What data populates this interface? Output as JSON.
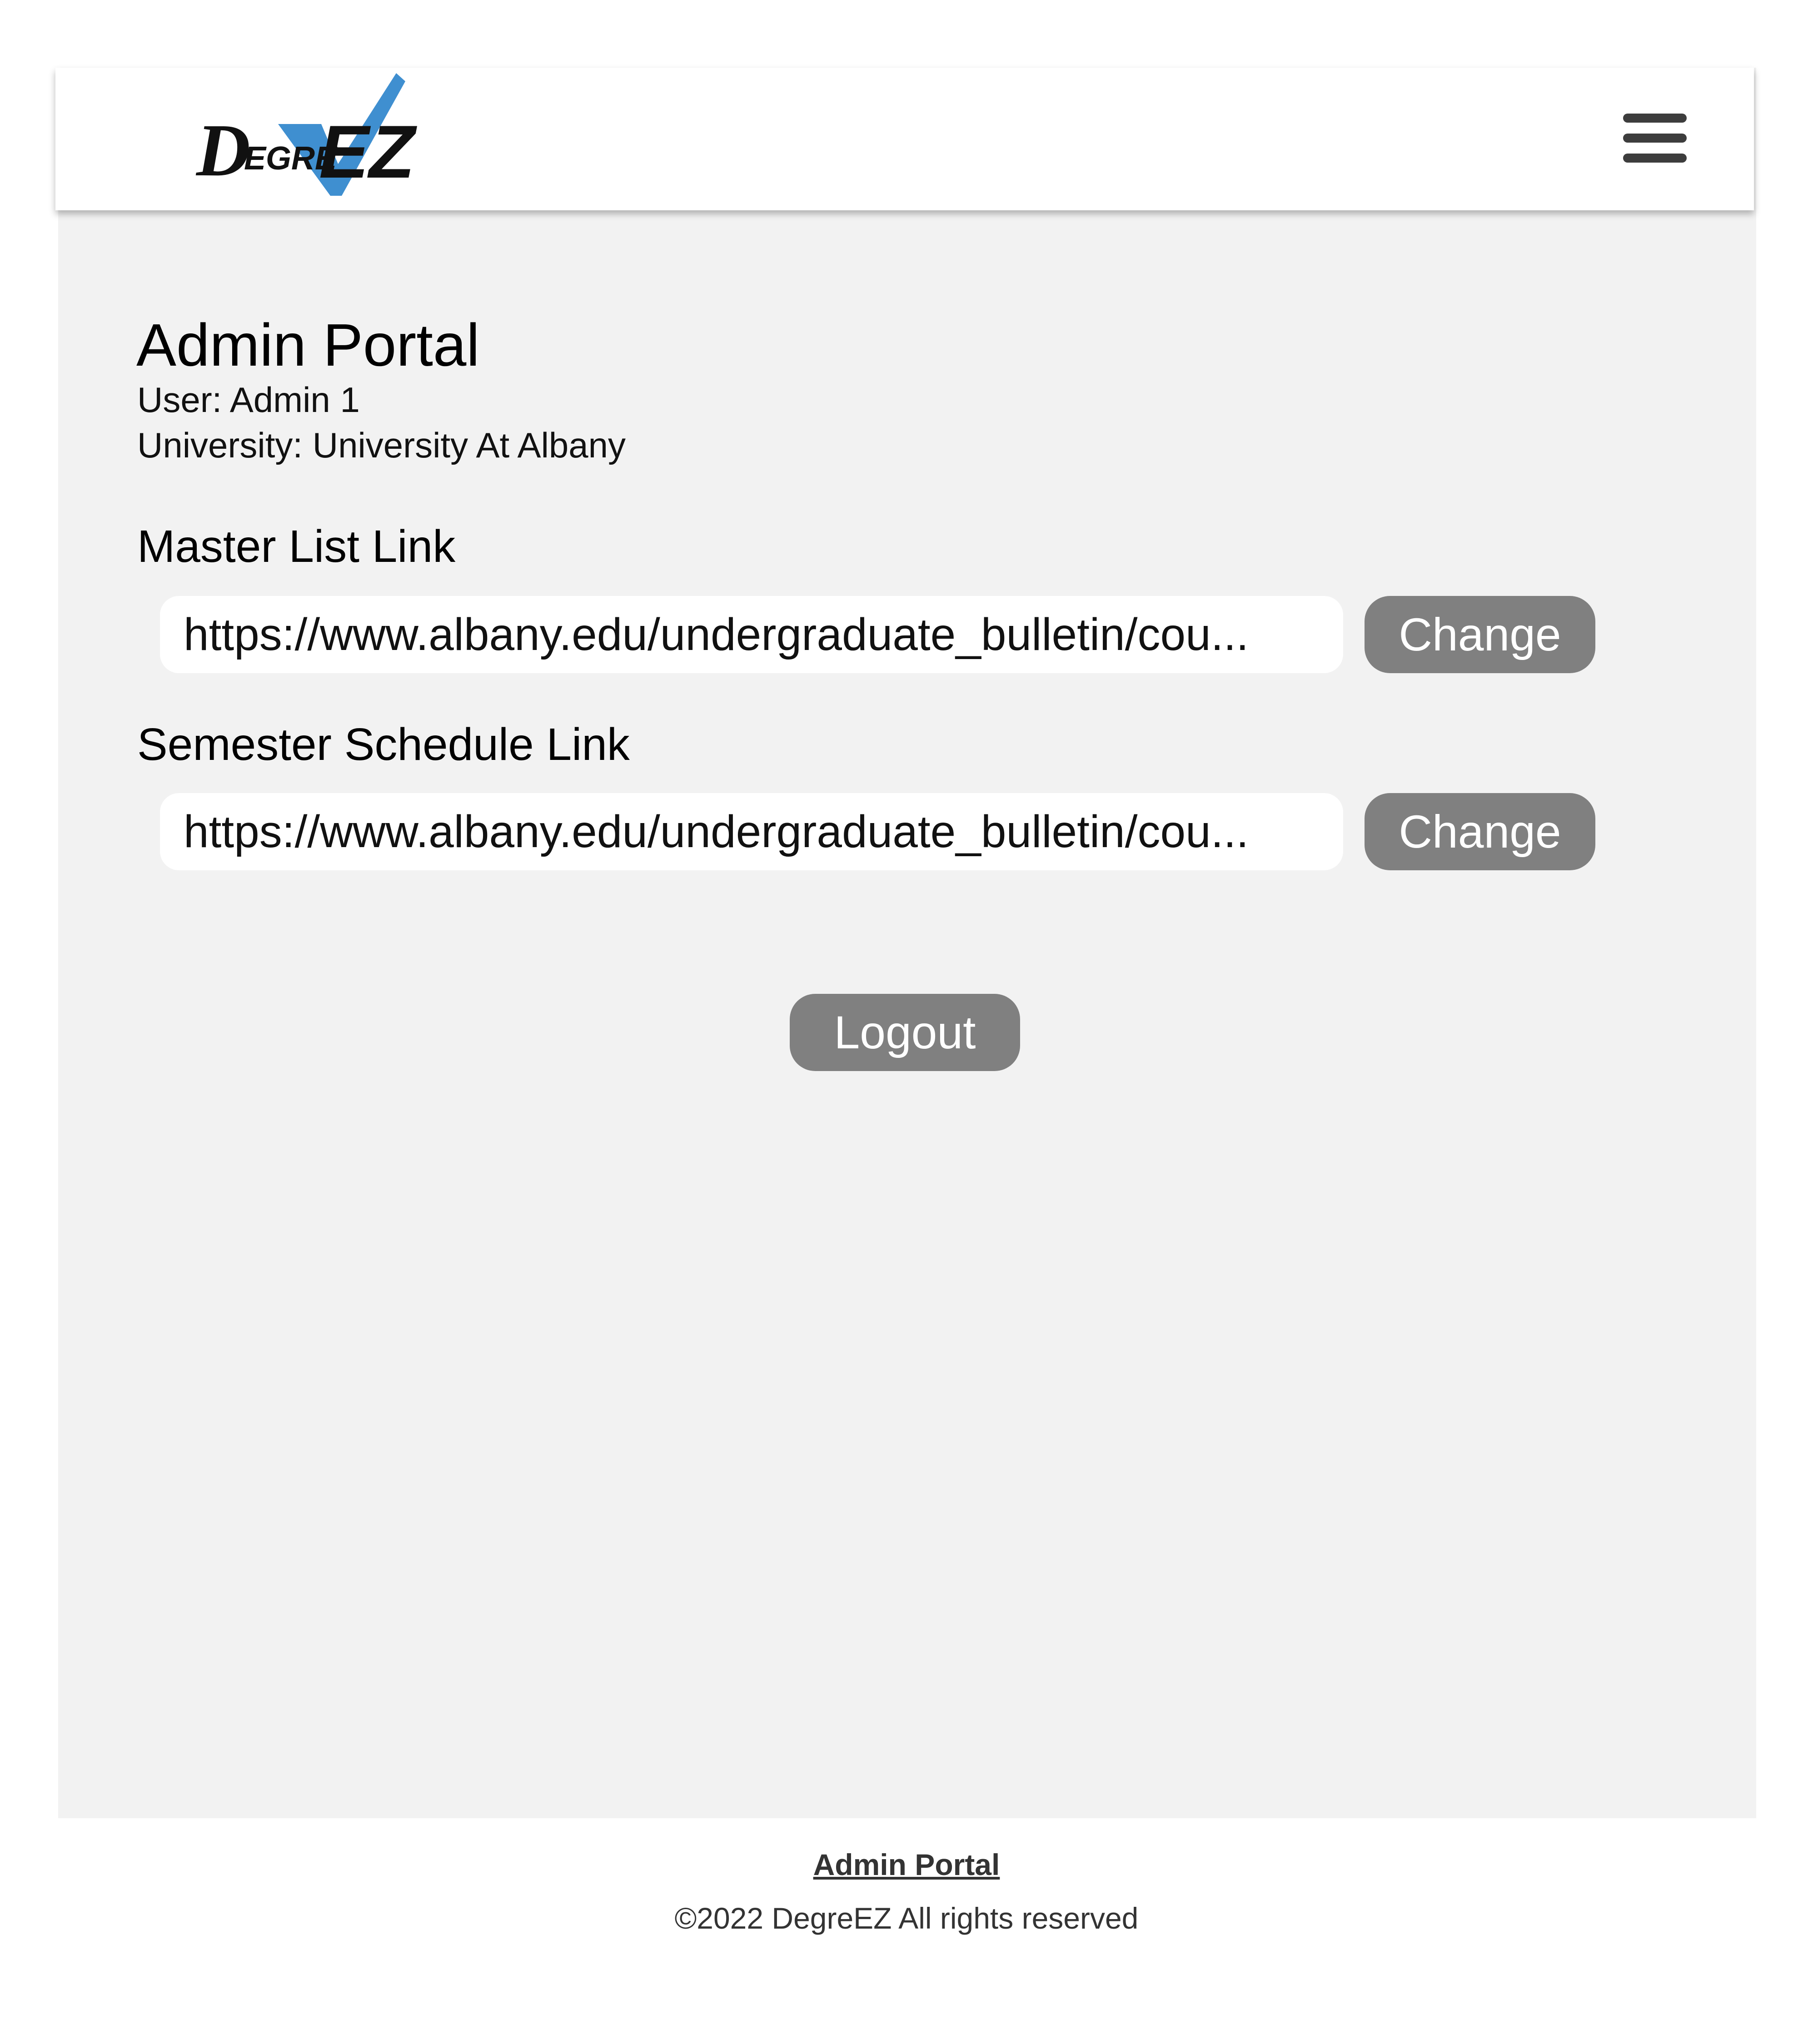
{
  "header": {
    "logo": {
      "text_initial": "D",
      "text_middle": "EGRE",
      "text_end": "EZ",
      "check_color": "#3f8fd0",
      "icon": "checkmark-icon"
    },
    "menu_icon": "hamburger-menu-icon"
  },
  "main": {
    "title": "Admin Portal",
    "user_line": "User: Admin 1",
    "university_line": "University: University At Albany",
    "master_list": {
      "label": "Master List Link",
      "value": "https://www.albany.edu/undergraduate_bulletin/cou...",
      "button": "Change"
    },
    "semester_schedule": {
      "label": "Semester Schedule Link",
      "value": "https://www.albany.edu/undergraduate_bulletin/cou...",
      "button": "Change"
    },
    "logout_button": "Logout"
  },
  "footer": {
    "link": "Admin Portal",
    "copyright": "©2022 DegreEZ All rights reserved"
  },
  "colors": {
    "page_background": "#f2f2f2",
    "button_background": "#808080",
    "button_text": "#ffffff",
    "logo_accent": "#3f8fd0"
  }
}
